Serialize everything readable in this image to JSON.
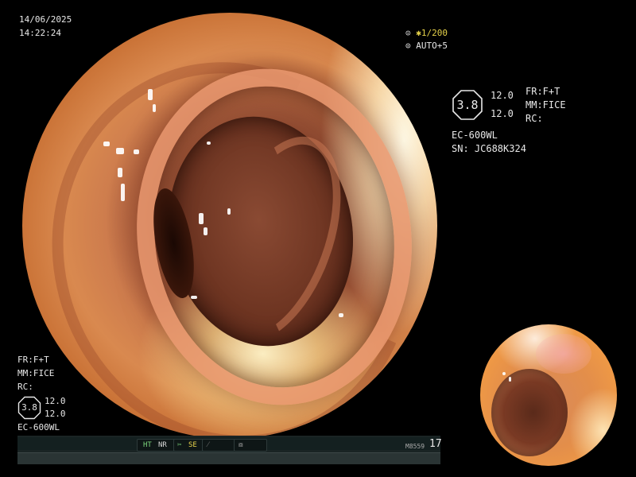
{
  "timestamp": {
    "date": "14/06/2025",
    "time": "14:22:24"
  },
  "exposure": {
    "shutter": "1/200",
    "auto": "AUTO+5"
  },
  "right_panel": {
    "enhancement_badge": "3.8",
    "value_top": "12.0",
    "value_bottom": "12.0",
    "fr": "FR:F+T",
    "mm": "MM:FICE",
    "rc": "RC:",
    "scope_model": "EC-600WL",
    "serial": "SN: JC688K324"
  },
  "left_panel": {
    "fr": "FR:F+T",
    "mm": "MM:FICE",
    "rc": "RC:",
    "enhancement_badge": "3.8",
    "value_top": "12.0",
    "value_bottom": "12.0",
    "scope_model": "EC-600WL"
  },
  "status_bar": {
    "ht": "HT",
    "nr": "NR",
    "se": "SE",
    "code": "M8559",
    "count": "17"
  },
  "colors": {
    "overlay_text": "#e8e8e8",
    "exposure_text": "#e6d24a",
    "status_green": "#9fe09f",
    "background": "#000000"
  },
  "icons": {
    "aperture": "aperture-icon",
    "star": "star-icon",
    "scissors": "scissors-icon",
    "function": "function-icon",
    "settings": "circle-settings-icon"
  }
}
